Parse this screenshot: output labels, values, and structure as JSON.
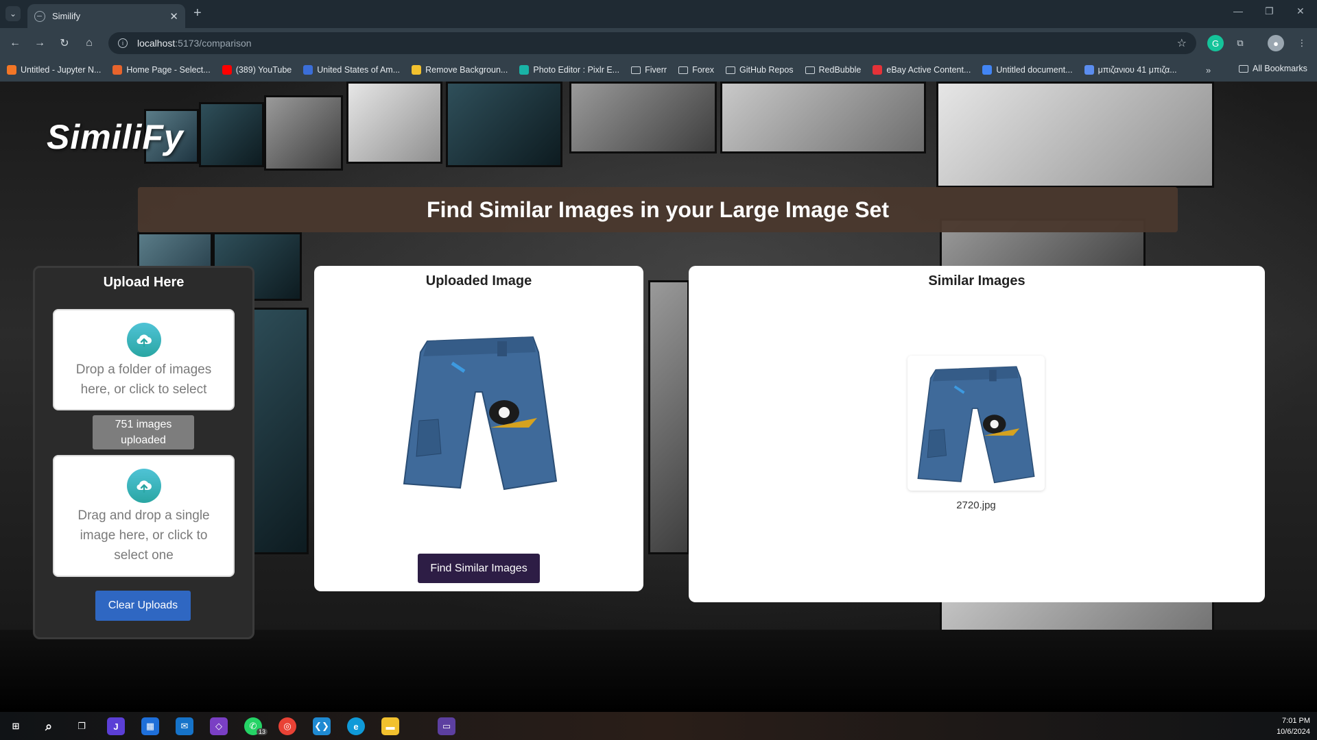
{
  "browser": {
    "tab_title": "Similify",
    "tab_close": "✕",
    "new_tab": "+",
    "url_host": "localhost",
    "url_path": ":5173/comparison",
    "bookmarks": [
      {
        "label": "Untitled - Jupyter N...",
        "icon": "jupyter-icon",
        "color": "#f37626"
      },
      {
        "label": "Home Page - Select...",
        "icon": "select-icon",
        "color": "#e8642c"
      },
      {
        "label": "(389) YouTube",
        "icon": "youtube-icon",
        "color": "#ff0000"
      },
      {
        "label": "United States of Am...",
        "icon": "document-icon",
        "color": "#3b6ed8"
      },
      {
        "label": "Remove Backgroun...",
        "icon": "removebg-icon",
        "color": "#f2c12e"
      },
      {
        "label": "Photo Editor : Pixlr E...",
        "icon": "pixlr-icon",
        "color": "#19b3a6"
      },
      {
        "label": "Fiverr",
        "icon": "folder-icon",
        "color": ""
      },
      {
        "label": "Forex",
        "icon": "folder-icon",
        "color": ""
      },
      {
        "label": "GitHub Repos",
        "icon": "folder-icon",
        "color": ""
      },
      {
        "label": "RedBubble",
        "icon": "folder-icon",
        "color": ""
      },
      {
        "label": "eBay Active Content...",
        "icon": "ebay-icon",
        "color": "#e53238"
      },
      {
        "label": "Untitled document...",
        "icon": "docs-icon",
        "color": "#4285f4"
      },
      {
        "label": "μπιζανιου 41 μπιζα...",
        "icon": "site-icon",
        "color": "#5b8def"
      }
    ],
    "bookmarks_more": "»",
    "all_bookmarks": "All Bookmarks"
  },
  "app": {
    "logo": "SimiliFy",
    "headline": "Find Similar Images in your Large Image Set",
    "upload": {
      "title": "Upload Here",
      "folder_drop_text": "Drop a folder of images here, or click to select",
      "count_text": "751 images uploaded",
      "single_drop_text": "Drag and drop a single image here, or click to select one",
      "clear_label": "Clear Uploads"
    },
    "uploaded": {
      "title": "Uploaded Image",
      "find_label": "Find Similar Images"
    },
    "similar": {
      "title": "Similar Images",
      "results": [
        {
          "filename": "2720.jpg"
        }
      ]
    }
  },
  "taskbar": {
    "whatsapp_badge": "13",
    "time": "7:01 PM",
    "date": "10/6/2024"
  }
}
